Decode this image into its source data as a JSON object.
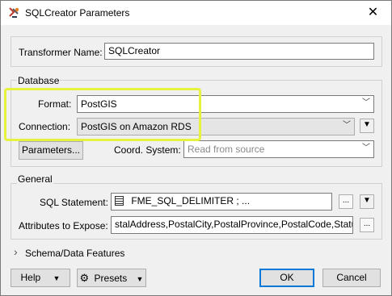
{
  "window": {
    "title": "SQLCreator Parameters",
    "close_glyph": "✕"
  },
  "transformer": {
    "label": "Transformer Name:",
    "value": "SQLCreator"
  },
  "database": {
    "group_title": "Database",
    "format_label": "Format:",
    "format_value": "PostGIS",
    "connection_label": "Connection:",
    "connection_value": "PostGIS on Amazon RDS",
    "parameters_button": "Parameters...",
    "coord_label": "Coord. System:",
    "coord_placeholder": "Read from source"
  },
  "general": {
    "group_title": "General",
    "sql_label": "SQL Statement:",
    "sql_value": "FME_SQL_DELIMITER ; ...",
    "attrs_label": "Attributes to Expose:",
    "attrs_value": "stalAddress,PostalCity,PostalProvince,PostalCode,Status",
    "ellipsis": "..."
  },
  "schema": {
    "label": "Schema/Data Features",
    "chevron": "›"
  },
  "footer": {
    "help": "Help",
    "presets": "Presets",
    "ok": "OK",
    "cancel": "Cancel"
  },
  "colors": {
    "highlight": "#e6f23d",
    "accent": "#0078d7"
  }
}
